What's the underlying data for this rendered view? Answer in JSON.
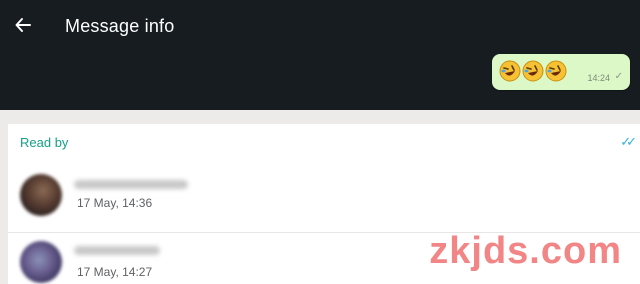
{
  "header": {
    "title": "Message info"
  },
  "message": {
    "emojis": [
      "rolling-on-floor-laughing-emoji",
      "rolling-on-floor-laughing-emoji",
      "rolling-on-floor-laughing-emoji"
    ],
    "time": "14:24",
    "tick": "✓"
  },
  "read_section": {
    "label": "Read by",
    "tick": "✓✓",
    "contacts": [
      {
        "time": "17 May, 14:36"
      },
      {
        "time": "17 May, 14:27"
      }
    ]
  },
  "watermark": "zkjds.com",
  "colors": {
    "header_bg": "#161c1f",
    "bubble_bg": "#dcf8c6",
    "accent": "#16a085",
    "read_tick": "#33b2d8",
    "watermark": "#f07070"
  }
}
